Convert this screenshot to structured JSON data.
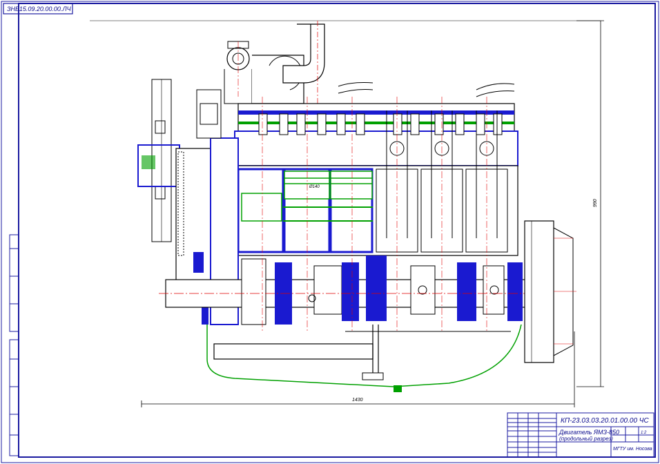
{
  "top_left_stamp": "ЗНБ15.09.20.00.00.ЛЧ",
  "dimensions": {
    "overall_length": "1430",
    "overall_height": "990",
    "bore": "Ø140"
  },
  "title_block": {
    "document_code": "КП-23.03.03.20.01.00.00 ЧС",
    "name_line1": "Двигатель ЯМЗ-850",
    "name_line2": "(продольный разрез)",
    "scale": "1:2",
    "organisation": "МГТУ им. Носова"
  },
  "colors": {
    "frame": "#1a1aa0",
    "axis": "#e00000",
    "part_fill": "#1a1ad0",
    "oil_line": "#00a000",
    "outline": "#000000"
  }
}
